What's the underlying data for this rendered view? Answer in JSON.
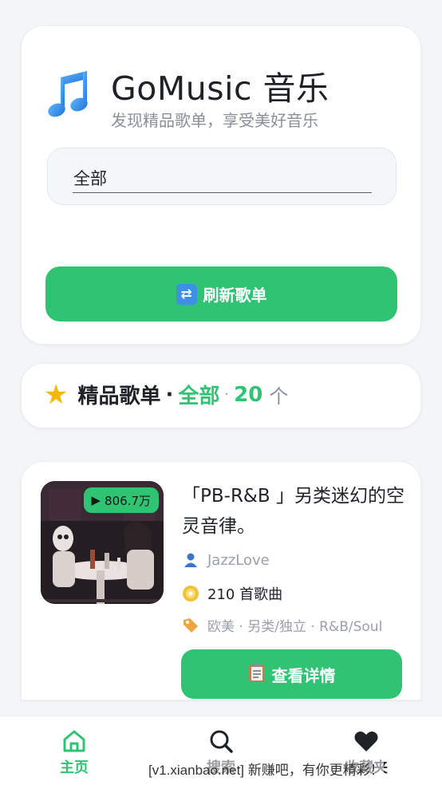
{
  "header": {
    "title": "GoMusic 音乐",
    "subtitle": "发现精品歌单，享受美好音乐",
    "logo_icon": "music-note-icon"
  },
  "filter": {
    "selected": "全部"
  },
  "refresh_button": {
    "label": "刷新歌单",
    "icon": "refresh-icon"
  },
  "section": {
    "title": "精品歌单",
    "separator": "·",
    "category": "全部",
    "separator2": "·",
    "count": "20",
    "unit": "个",
    "icon": "star-icon"
  },
  "playlists": [
    {
      "title": "「PB-R&B 」另类迷幻的空灵音律。",
      "plays": "806.7万",
      "author": "JazzLove",
      "songs": "210 首歌曲",
      "tags": "欧美 · 另类/独立 · R&B/Soul",
      "detail_label": "查看详情"
    }
  ],
  "bottom_nav": {
    "items": [
      {
        "label": "主页",
        "icon": "home-icon"
      },
      {
        "label": "搜索",
        "icon": "search-icon"
      },
      {
        "label": "收藏夹",
        "icon": "heart-icon"
      }
    ]
  },
  "watermark": "[v1.xianbao.net] 新赚吧，有你更精彩！",
  "colors": {
    "accent": "#31c374",
    "star": "#f5b800",
    "background": "#f4f5f7"
  }
}
